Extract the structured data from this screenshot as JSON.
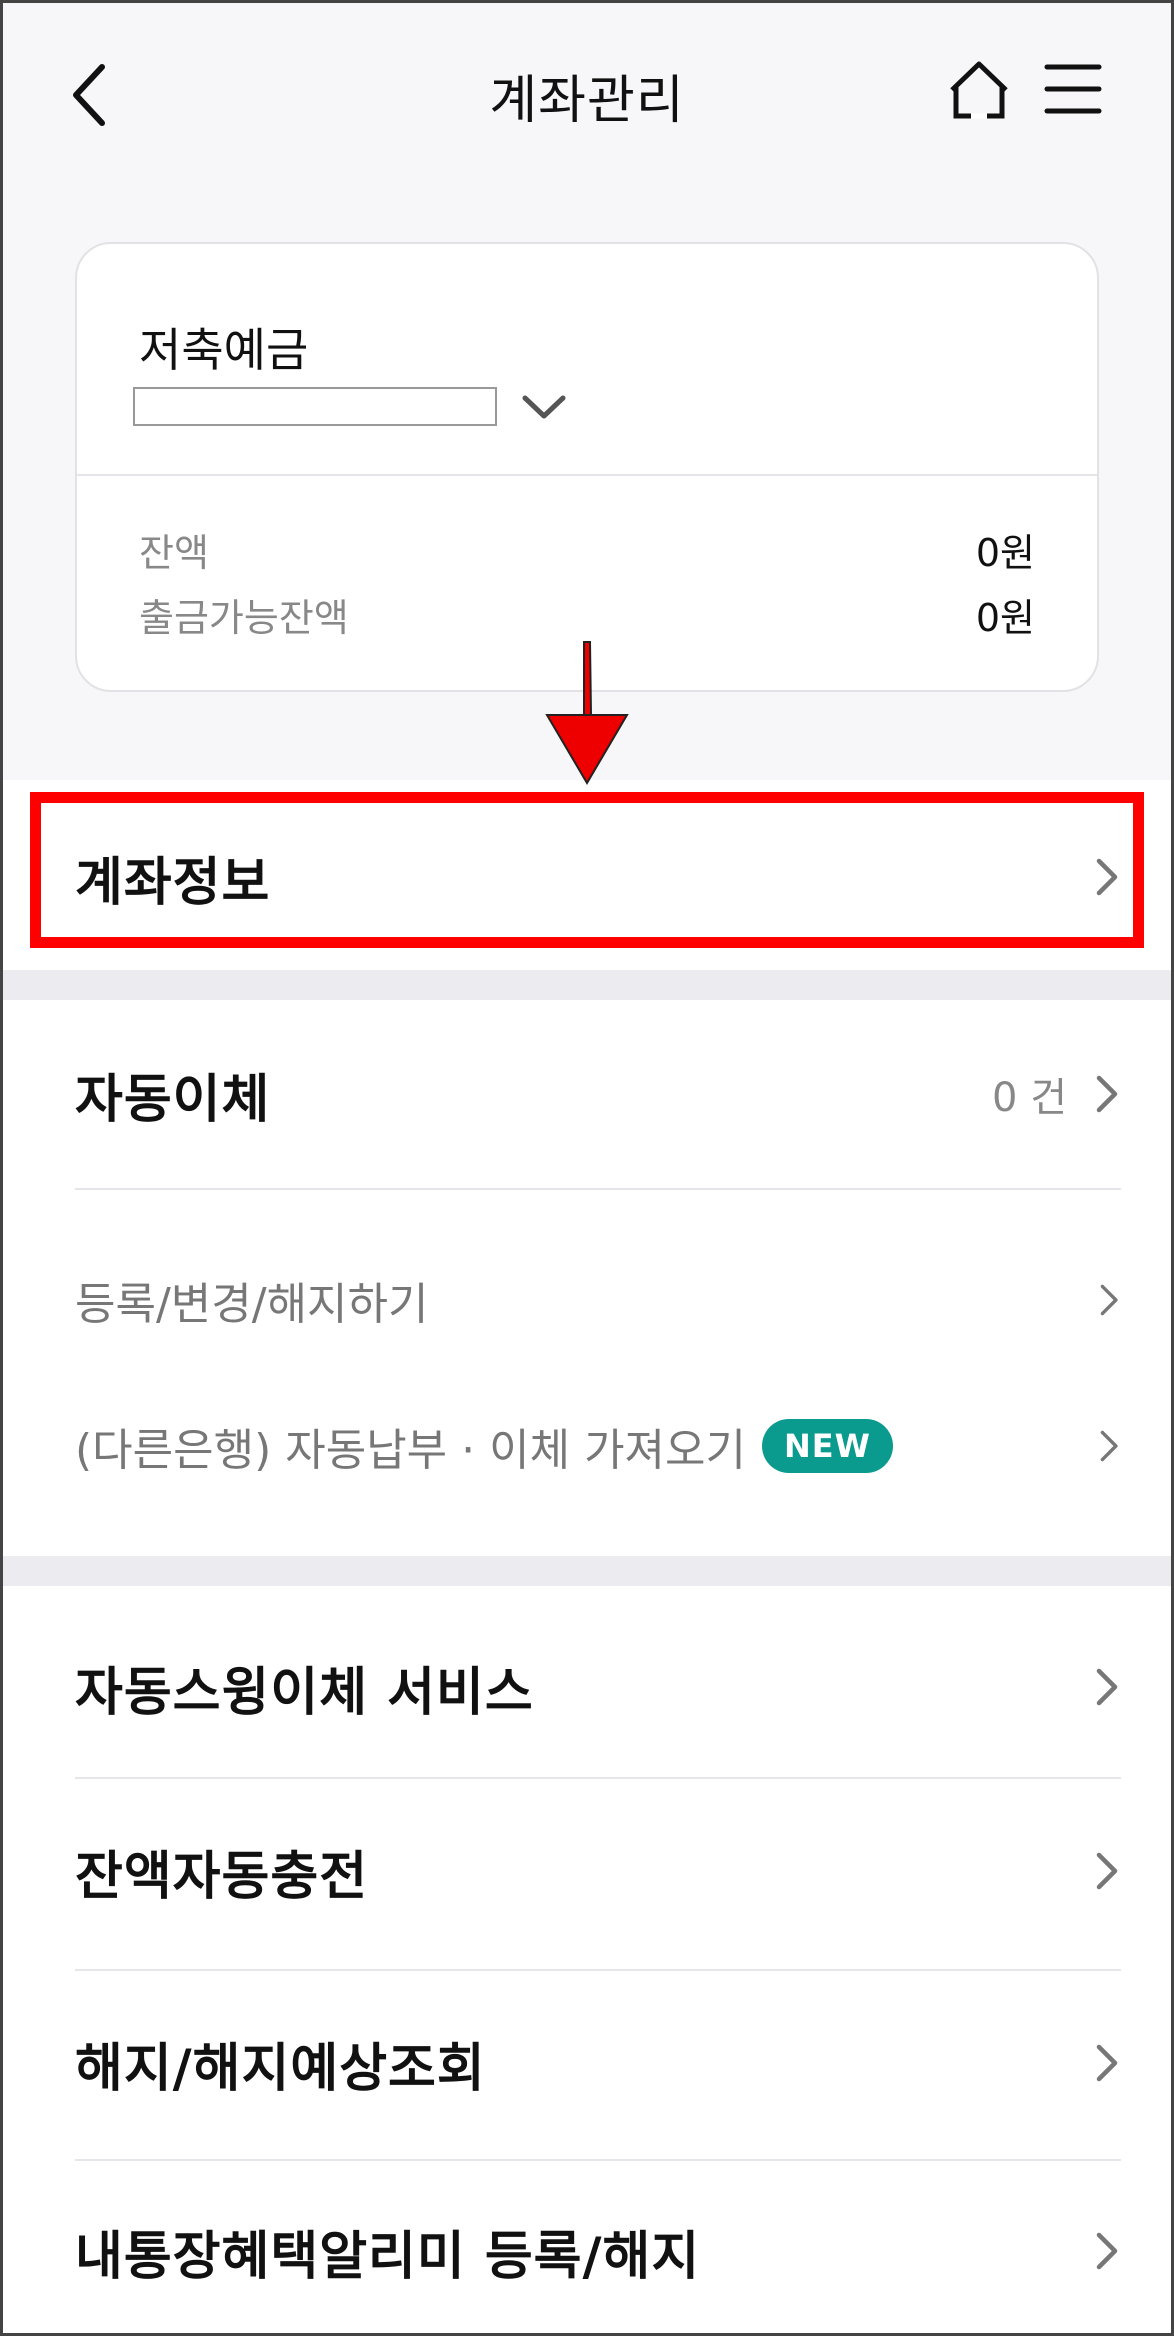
{
  "header": {
    "title": "계좌관리",
    "back_icon": "chevron-left-icon",
    "home_icon": "home-icon",
    "menu_icon": "hamburger-menu-icon"
  },
  "account": {
    "name": "저축예금",
    "number": "",
    "balance_label": "잔액",
    "balance_value": "0원",
    "available_label": "출금가능잔액",
    "available_value": "0원"
  },
  "menu": {
    "account_info": "계좌정보",
    "auto_transfer": "자동이체",
    "auto_transfer_count": "0 건",
    "register_change": "등록/변경/해지하기",
    "import_other_bank": "(다른은행) 자동납부 · 이체 가져오기",
    "new_badge": "NEW",
    "swing_transfer": "자동스윙이체 서비스",
    "auto_charge": "잔액자동충전",
    "termination": "해지/해지예상조회",
    "passbook_alert": "내통장혜택알리미 등록/해지"
  },
  "colors": {
    "highlight": "#ff0000",
    "badge": "#0a9b8e",
    "background": "#f7f7f9"
  }
}
